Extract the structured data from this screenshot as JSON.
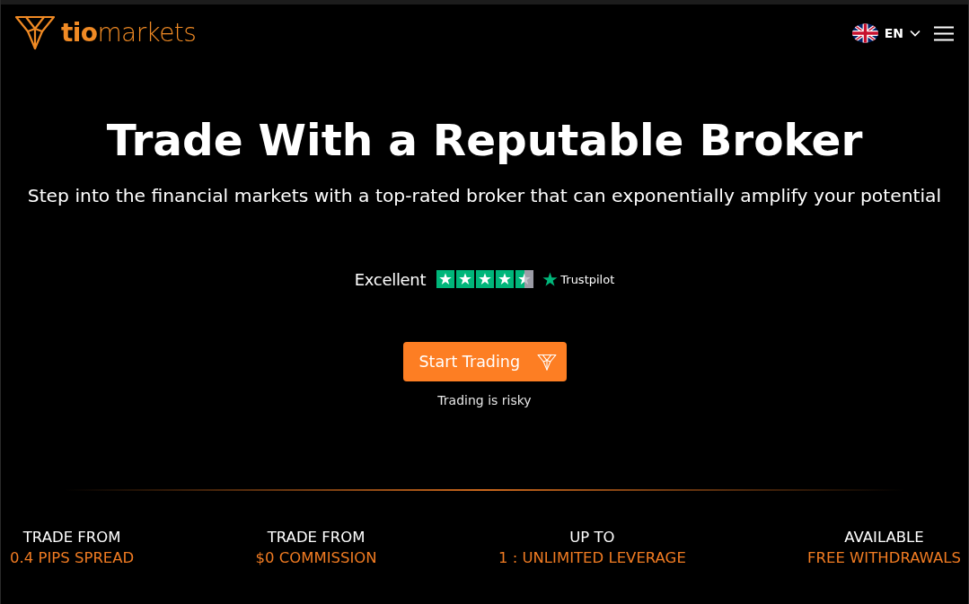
{
  "header": {
    "logo": "**tio**markets",
    "language": "EN"
  },
  "hero": {
    "title": "Trade With a Reputable Broker",
    "subtitle": "Step into the financial markets with a top-rated broker that can exponentially amplify your potential",
    "rating": {
      "label": "Excellent",
      "stars": 4.5,
      "brand": "Trustpilot"
    },
    "cta_button": "Start Trading",
    "risk_note": "Trading is risky"
  },
  "stats": [
    {
      "label": "TRADE FROM",
      "value": "0.4 PIPS SPREAD"
    },
    {
      "label": "TRADE FROM",
      "value": "$0 COMMISSION"
    },
    {
      "label": "UP TO",
      "value": "1 : UNLIMITED LEVERAGE"
    },
    {
      "label": "AVAILABLE",
      "value": "FREE WITHDRAWALS"
    }
  ]
}
